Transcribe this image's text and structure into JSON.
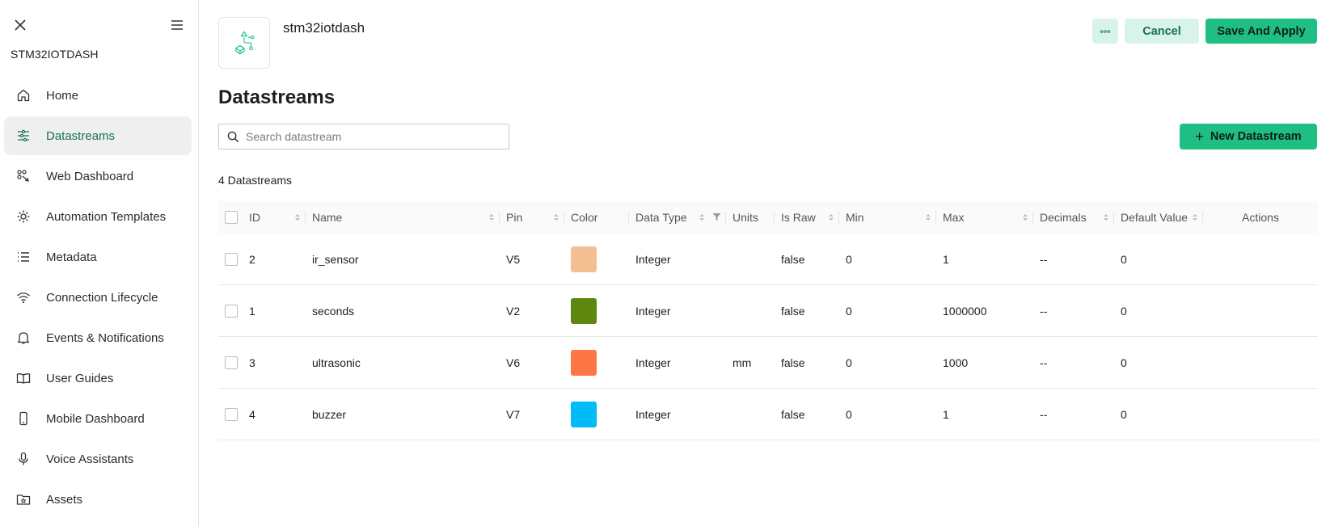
{
  "sidebar": {
    "title": "STM32IOTDASH",
    "items": [
      {
        "label": "Home",
        "icon": "home-icon"
      },
      {
        "label": "Datastreams",
        "icon": "datastreams-icon",
        "active": true
      },
      {
        "label": "Web Dashboard",
        "icon": "web-dashboard-icon"
      },
      {
        "label": "Automation Templates",
        "icon": "automation-icon"
      },
      {
        "label": "Metadata",
        "icon": "list-icon"
      },
      {
        "label": "Connection Lifecycle",
        "icon": "wifi-icon"
      },
      {
        "label": "Events & Notifications",
        "icon": "bell-icon"
      },
      {
        "label": "User Guides",
        "icon": "book-icon"
      },
      {
        "label": "Mobile Dashboard",
        "icon": "mobile-icon"
      },
      {
        "label": "Voice Assistants",
        "icon": "microphone-icon"
      },
      {
        "label": "Assets",
        "icon": "folder-star-icon"
      }
    ]
  },
  "header": {
    "template_name": "stm32iotdash",
    "cancel_label": "Cancel",
    "save_label": "Save And Apply"
  },
  "main": {
    "title": "Datastreams",
    "search_placeholder": "Search datastream",
    "new_button_label": "New Datastream",
    "count_label": "4 Datastreams"
  },
  "table": {
    "columns": [
      "ID",
      "Name",
      "Pin",
      "Color",
      "Data Type",
      "Units",
      "Is Raw",
      "Min",
      "Max",
      "Decimals",
      "Default Value",
      "Actions"
    ],
    "rows": [
      {
        "id": "2",
        "name": "ir_sensor",
        "pin": "V5",
        "color": "#f5bf94",
        "type": "Integer",
        "units": "",
        "raw": "false",
        "min": "0",
        "max": "1",
        "decimals": "--",
        "default": "0"
      },
      {
        "id": "1",
        "name": "seconds",
        "pin": "V2",
        "color": "#5f870f",
        "type": "Integer",
        "units": "",
        "raw": "false",
        "min": "0",
        "max": "1000000",
        "decimals": "--",
        "default": "0"
      },
      {
        "id": "3",
        "name": "ultrasonic",
        "pin": "V6",
        "color": "#fd7646",
        "type": "Integer",
        "units": "mm",
        "raw": "false",
        "min": "0",
        "max": "1000",
        "decimals": "--",
        "default": "0"
      },
      {
        "id": "4",
        "name": "buzzer",
        "pin": "V7",
        "color": "#00bbf9",
        "type": "Integer",
        "units": "",
        "raw": "false",
        "min": "0",
        "max": "1",
        "decimals": "--",
        "default": "0"
      }
    ]
  },
  "colors": {
    "accent": "#1fbf84",
    "accent_light": "#d8f3ea",
    "active_text": "#13705b"
  }
}
